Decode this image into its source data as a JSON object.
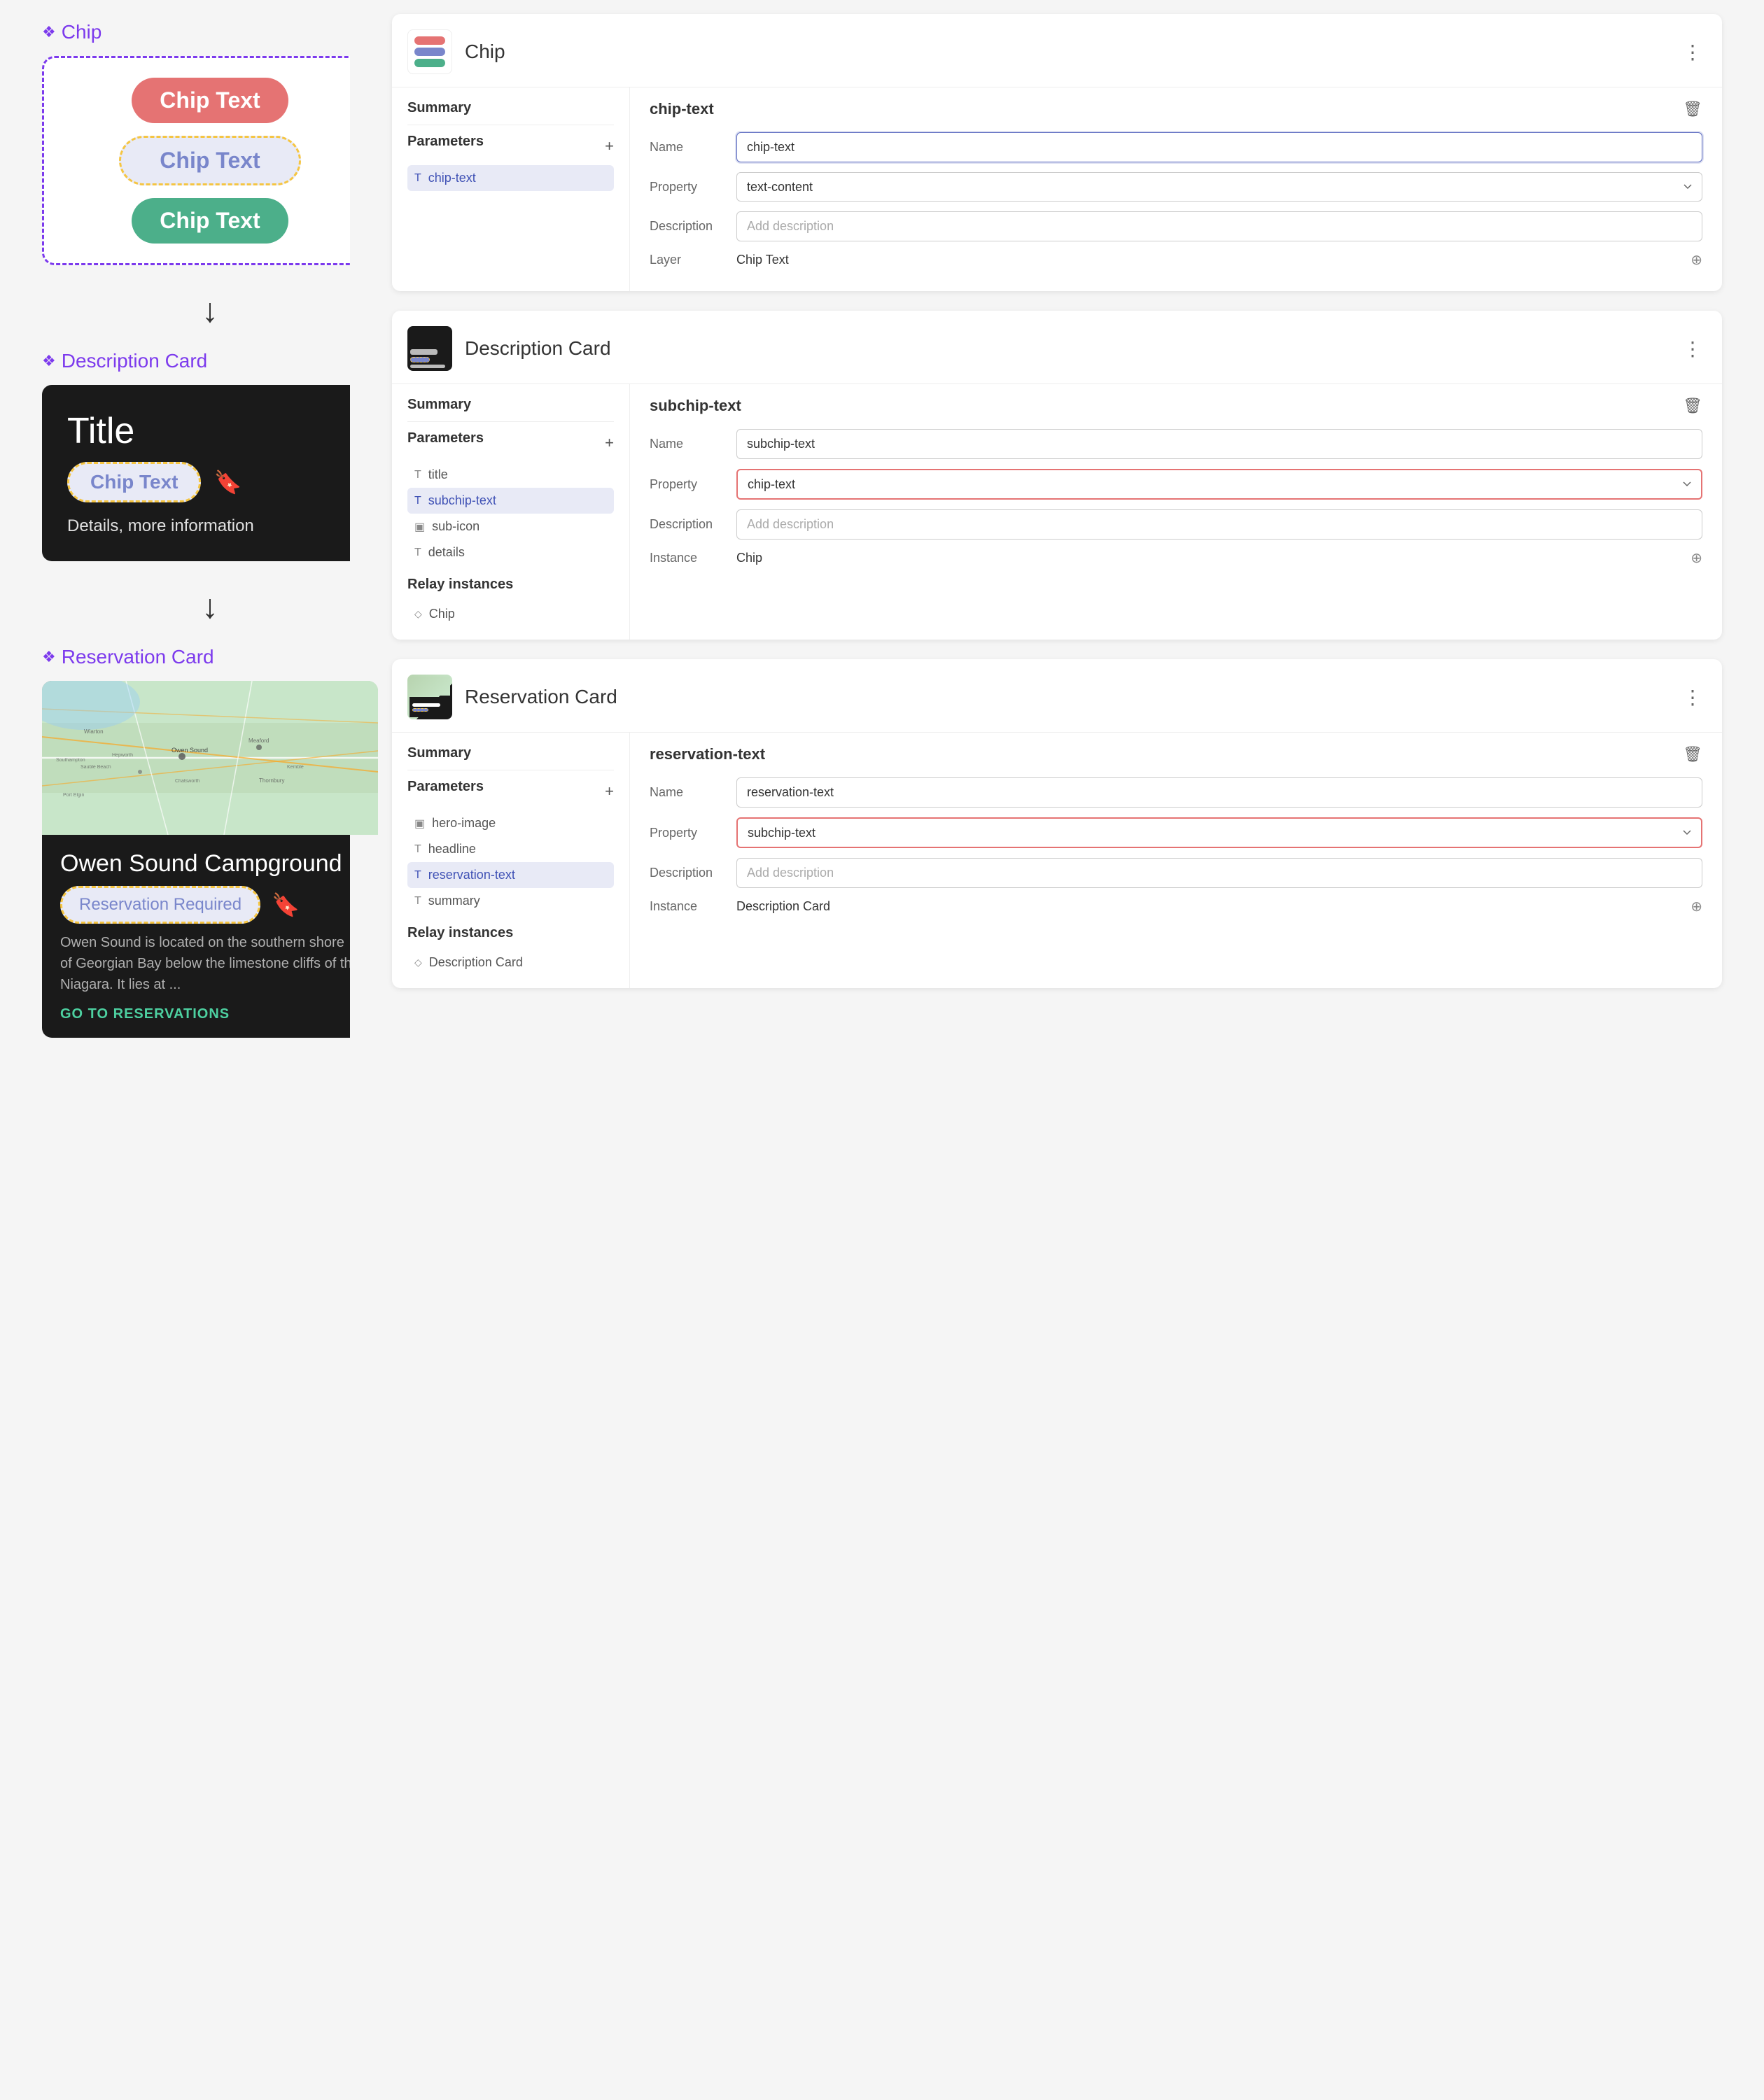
{
  "left": {
    "chip_section": {
      "title": "Chip",
      "chip1": "Chip Text",
      "chip2": "Chip Text",
      "chip3": "Chip Text"
    },
    "description_section": {
      "title": "Description Card",
      "card_title": "Title",
      "chip_text": "Chip Text",
      "details": "Details, more information"
    },
    "reservation_section": {
      "title": "Reservation Card",
      "headline": "Owen Sound Campground",
      "chip_text": "Reservation Required",
      "summary": "Owen Sound is located on the southern shore of Georgian Bay below the limestone cliffs of the Niagara. It lies at ...",
      "cta": "GO TO RESERVATIONS"
    }
  },
  "right": {
    "chip_card": {
      "name": "Chip",
      "more_label": "⋮",
      "summary_label": "Summary",
      "summary_value": "chip-text",
      "parameters_label": "Parameters",
      "params": [
        {
          "icon": "T",
          "label": "chip-text",
          "active": true
        }
      ],
      "prop_name_label": "Name",
      "prop_name_value": "chip-text",
      "prop_property_label": "Property",
      "prop_property_value": "text-content",
      "prop_description_label": "Description",
      "prop_description_placeholder": "Add description",
      "prop_layer_label": "Layer",
      "prop_layer_value": "Chip Text",
      "trash_icon": "🗑",
      "target_icon": "⊕"
    },
    "description_card": {
      "name": "Description Card",
      "more_label": "⋮",
      "summary_label": "Summary",
      "summary_value": "subchip-text",
      "parameters_label": "Parameters",
      "params": [
        {
          "icon": "T",
          "label": "title",
          "active": false
        },
        {
          "icon": "T",
          "label": "subchip-text",
          "active": true
        },
        {
          "icon": "▣",
          "label": "sub-icon",
          "active": false
        },
        {
          "icon": "T",
          "label": "details",
          "active": false
        }
      ],
      "relay_label": "Relay instances",
      "relay_items": [
        {
          "label": "Chip"
        }
      ],
      "prop_name_label": "Name",
      "prop_name_value": "subchip-text",
      "prop_property_label": "Property",
      "prop_property_value": "chip-text",
      "prop_description_label": "Description",
      "prop_description_placeholder": "Add description",
      "prop_instance_label": "Instance",
      "prop_instance_value": "Chip",
      "trash_icon": "🗑",
      "target_icon": "⊕"
    },
    "reservation_card": {
      "name": "Reservation Card",
      "more_label": "⋮",
      "summary_label": "Summary",
      "summary_value": "reservation-text",
      "parameters_label": "Parameters",
      "params": [
        {
          "icon": "▣",
          "label": "hero-image",
          "active": false
        },
        {
          "icon": "T",
          "label": "headline",
          "active": false
        },
        {
          "icon": "T",
          "label": "reservation-text",
          "active": true
        },
        {
          "icon": "T",
          "label": "summary",
          "active": false
        }
      ],
      "relay_label": "Relay instances",
      "relay_items": [
        {
          "label": "Description Card"
        }
      ],
      "prop_name_label": "Name",
      "prop_name_value": "reservation-text",
      "prop_property_label": "Property",
      "prop_property_value": "subchip-text",
      "prop_description_label": "Description",
      "prop_description_placeholder": "Add description",
      "prop_instance_label": "Instance",
      "prop_instance_value": "Description Card",
      "trash_icon": "🗑",
      "target_icon": "⊕"
    }
  },
  "arrows": {
    "down": "↓"
  },
  "icons": {
    "diamond": "❖",
    "plus": "+",
    "more": "⋮",
    "trash": "🗑",
    "target": "⊕",
    "bookmark": "🔖",
    "chevron_down": "∨"
  }
}
